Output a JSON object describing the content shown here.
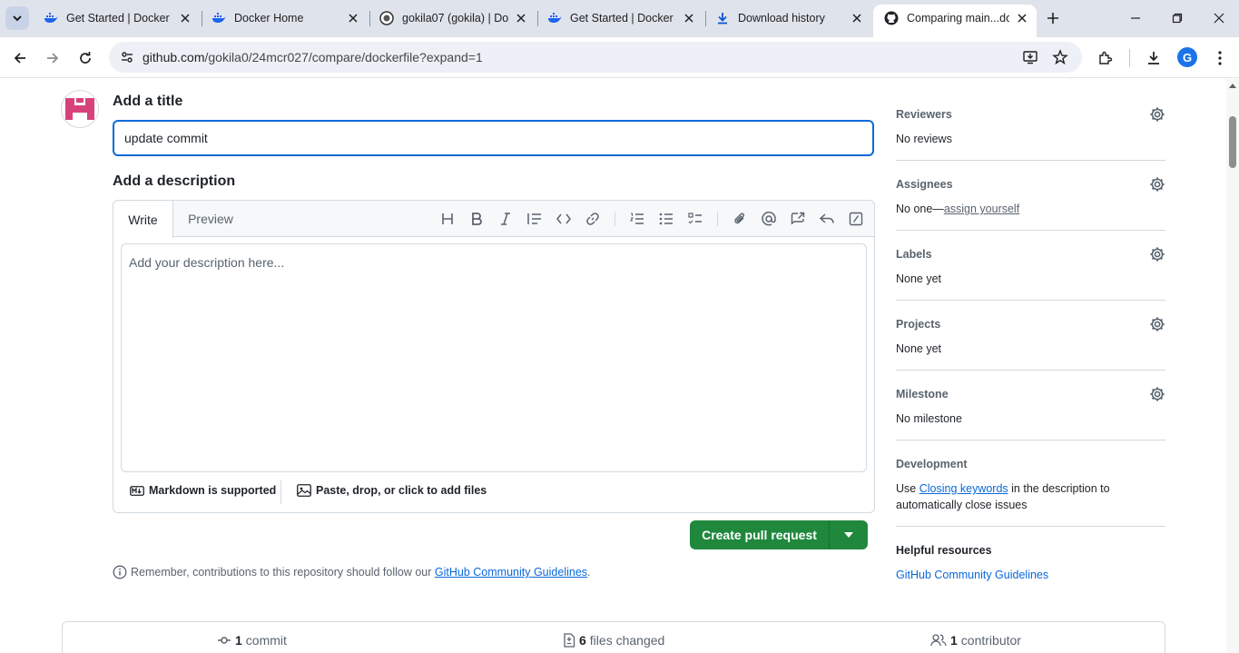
{
  "browser": {
    "tabs": [
      {
        "title": "Get Started | Docker",
        "icon": "docker-icon"
      },
      {
        "title": "Docker Home",
        "icon": "docker-icon"
      },
      {
        "title": "gokila07 (gokila) | Do",
        "icon": "dockerhub-avatar-icon"
      },
      {
        "title": "Get Started | Docker",
        "icon": "docker-icon"
      },
      {
        "title": "Download history",
        "icon": "download-icon"
      },
      {
        "title": "Comparing main...doc",
        "icon": "github-icon",
        "active": true
      }
    ],
    "url_host": "github.com",
    "url_path": "/gokila0/24mcr027/compare/dockerfile?expand=1",
    "profile_letter": "G"
  },
  "form": {
    "title_heading": "Add a title",
    "title_value": "update commit",
    "description_heading": "Add a description",
    "write_tab": "Write",
    "preview_tab": "Preview",
    "description_placeholder": "Add your description here...",
    "markdown_note": "Markdown is supported",
    "files_note": "Paste, drop, or click to add files",
    "submit_label": "Create pull request",
    "remember_prefix": "Remember, contributions to this repository should follow our",
    "remember_link": "GitHub Community Guidelines",
    "remember_suffix": "."
  },
  "sidebar": {
    "reviewers": {
      "title": "Reviewers",
      "value": "No reviews"
    },
    "assignees": {
      "title": "Assignees",
      "prefix": "No one—",
      "link": "assign yourself"
    },
    "labels": {
      "title": "Labels",
      "value": "None yet"
    },
    "projects": {
      "title": "Projects",
      "value": "None yet"
    },
    "milestone": {
      "title": "Milestone",
      "value": "No milestone"
    },
    "development": {
      "title": "Development",
      "prefix": "Use ",
      "link": "Closing keywords",
      "suffix": " in the description to automatically close issues"
    },
    "helpful": {
      "title": "Helpful resources",
      "link": "GitHub Community Guidelines"
    }
  },
  "stats": {
    "commits_count": "1",
    "commits_label": "commit",
    "files_count": "6",
    "files_label": "files changed",
    "contributors_count": "1",
    "contributors_label": "contributor"
  },
  "colors": {
    "accent": "#0969da",
    "primary_button": "#1f883d"
  }
}
